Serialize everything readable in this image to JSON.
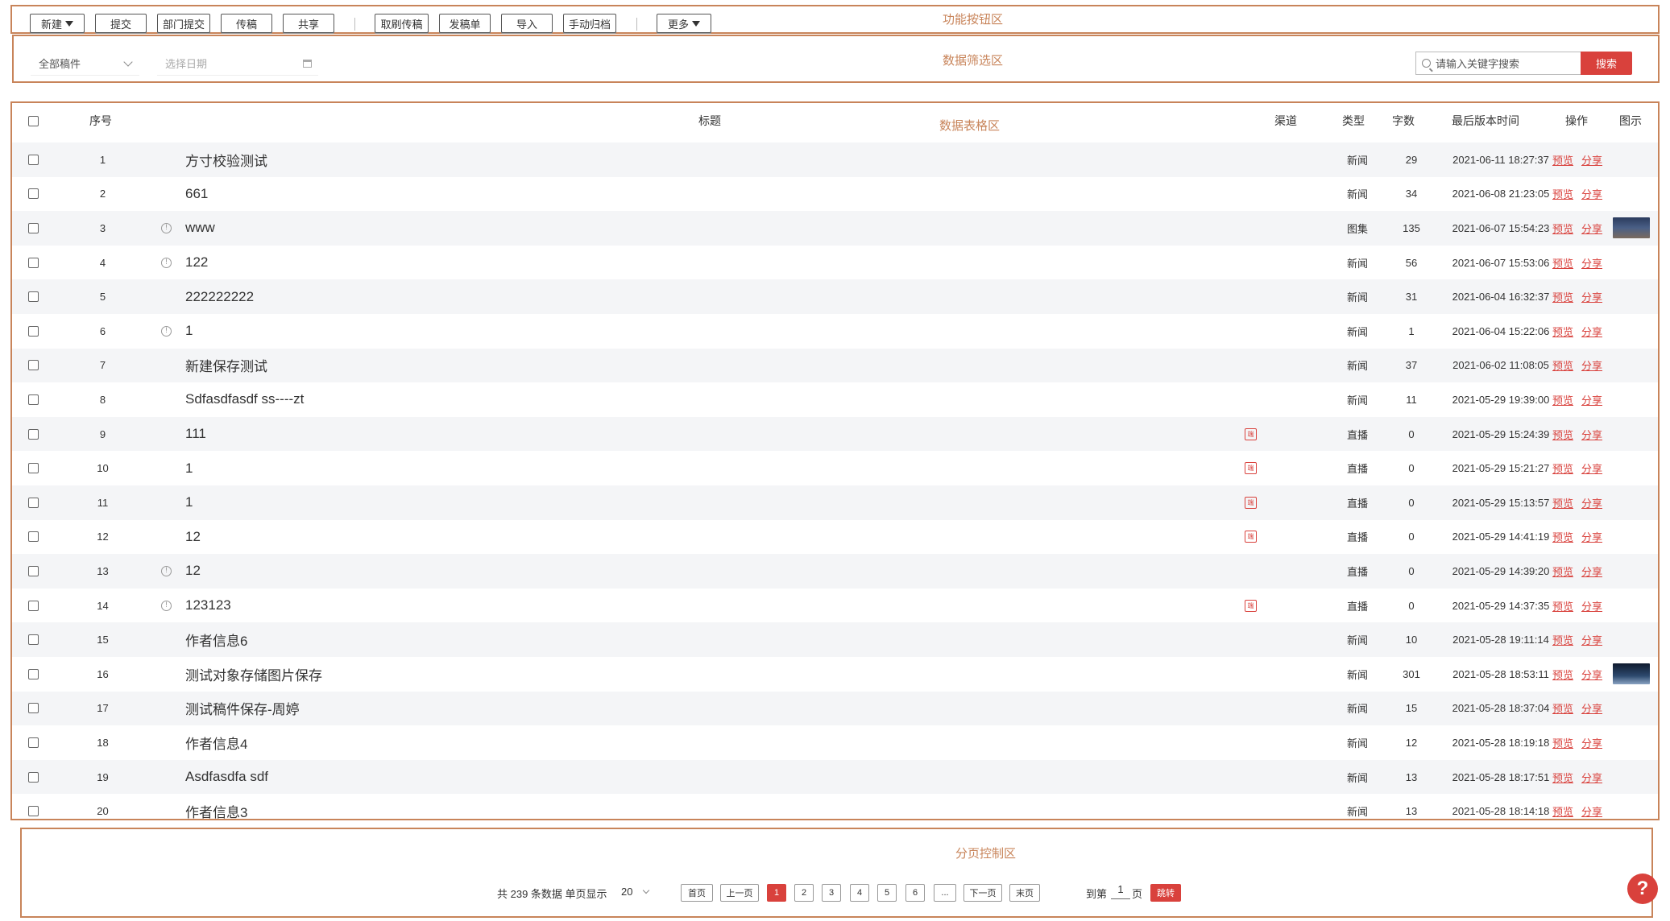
{
  "zones": {
    "toolbar_label": "功能按钮区",
    "filter_label": "数据筛选区",
    "table_label": "数据表格区",
    "pager_label": "分页控制区"
  },
  "toolbar": {
    "new": "新建",
    "submit": "提交",
    "dept_submit": "部门提交",
    "transmit": "传稿",
    "share": "共享",
    "cancel_transmit": "取刷传稿",
    "issue_list": "发稿单",
    "import": "导入",
    "manual_archive": "手动归档",
    "more": "更多"
  },
  "filter": {
    "scope": "全部稿件",
    "date_placeholder": "选择日期",
    "search_placeholder": "请输入关键字搜索",
    "search_button": "搜索"
  },
  "table": {
    "headers": {
      "index": "序号",
      "title": "标题",
      "channel": "渠道",
      "type": "类型",
      "words": "字数",
      "last_time": "最后版本时间",
      "actions": "操作",
      "image": "图示"
    },
    "preview_label": "预览",
    "share_label": "分享",
    "channel_glyph": "端",
    "info_glyph": "!",
    "rows": [
      {
        "no": "1",
        "info": false,
        "title": "方寸校验测试",
        "channel": false,
        "type": "新闻",
        "words": "29",
        "time": "2021-06-11 18:27:37",
        "thumb": ""
      },
      {
        "no": "2",
        "info": false,
        "title": "661",
        "channel": false,
        "type": "新闻",
        "words": "34",
        "time": "2021-06-08 21:23:05",
        "thumb": ""
      },
      {
        "no": "3",
        "info": true,
        "title": "www",
        "channel": false,
        "type": "图集",
        "words": "135",
        "time": "2021-06-07 15:54:23",
        "thumb": "a"
      },
      {
        "no": "4",
        "info": true,
        "title": "122",
        "channel": false,
        "type": "新闻",
        "words": "56",
        "time": "2021-06-07 15:53:06",
        "thumb": ""
      },
      {
        "no": "5",
        "info": false,
        "title": "222222222",
        "channel": false,
        "type": "新闻",
        "words": "31",
        "time": "2021-06-04 16:32:37",
        "thumb": ""
      },
      {
        "no": "6",
        "info": true,
        "title": "1",
        "channel": false,
        "type": "新闻",
        "words": "1",
        "time": "2021-06-04 15:22:06",
        "thumb": ""
      },
      {
        "no": "7",
        "info": false,
        "title": "新建保存测试",
        "channel": false,
        "type": "新闻",
        "words": "37",
        "time": "2021-06-02 11:08:05",
        "thumb": ""
      },
      {
        "no": "8",
        "info": false,
        "title": "Sdfasdfasdf ss----zt",
        "channel": false,
        "type": "新闻",
        "words": "11",
        "time": "2021-05-29 19:39:00",
        "thumb": ""
      },
      {
        "no": "9",
        "info": false,
        "title": "111",
        "channel": true,
        "type": "直播",
        "words": "0",
        "time": "2021-05-29 15:24:39",
        "thumb": ""
      },
      {
        "no": "10",
        "info": false,
        "title": "1",
        "channel": true,
        "type": "直播",
        "words": "0",
        "time": "2021-05-29 15:21:27",
        "thumb": ""
      },
      {
        "no": "11",
        "info": false,
        "title": "1",
        "channel": true,
        "type": "直播",
        "words": "0",
        "time": "2021-05-29 15:13:57",
        "thumb": ""
      },
      {
        "no": "12",
        "info": false,
        "title": "12",
        "channel": true,
        "type": "直播",
        "words": "0",
        "time": "2021-05-29 14:41:19",
        "thumb": ""
      },
      {
        "no": "13",
        "info": true,
        "title": "12",
        "channel": false,
        "type": "直播",
        "words": "0",
        "time": "2021-05-29 14:39:20",
        "thumb": ""
      },
      {
        "no": "14",
        "info": true,
        "title": "123123",
        "channel": true,
        "type": "直播",
        "words": "0",
        "time": "2021-05-29 14:37:35",
        "thumb": ""
      },
      {
        "no": "15",
        "info": false,
        "title": "作者信息6",
        "channel": false,
        "type": "新闻",
        "words": "10",
        "time": "2021-05-28 19:11:14",
        "thumb": ""
      },
      {
        "no": "16",
        "info": false,
        "title": "测试对象存储图片保存",
        "channel": false,
        "type": "新闻",
        "words": "301",
        "time": "2021-05-28 18:53:11",
        "thumb": "b"
      },
      {
        "no": "17",
        "info": false,
        "title": "测试稿件保存-周婷",
        "channel": false,
        "type": "新闻",
        "words": "15",
        "time": "2021-05-28 18:37:04",
        "thumb": ""
      },
      {
        "no": "18",
        "info": false,
        "title": "作者信息4",
        "channel": false,
        "type": "新闻",
        "words": "12",
        "time": "2021-05-28 18:19:18",
        "thumb": ""
      },
      {
        "no": "19",
        "info": false,
        "title": "Asdfasdfa sdf",
        "channel": false,
        "type": "新闻",
        "words": "13",
        "time": "2021-05-28 18:17:51",
        "thumb": ""
      },
      {
        "no": "20",
        "info": false,
        "title": "作者信息3",
        "channel": false,
        "type": "新闻",
        "words": "13",
        "time": "2021-05-28 18:14:18",
        "thumb": ""
      }
    ]
  },
  "pager": {
    "total_text": "共 239 条数据 单页显示",
    "page_size": "20",
    "first": "首页",
    "prev": "上一页",
    "pages": [
      "1",
      "2",
      "3",
      "4",
      "5",
      "6"
    ],
    "ellipsis": "...",
    "next": "下一页",
    "last": "末页",
    "goto_prefix": "到第",
    "goto_value": "1",
    "goto_suffix": "页",
    "jump": "跳转"
  },
  "help_glyph": "?",
  "colors": {
    "accent": "#d9413c",
    "annotation": "#c8845a",
    "row_alt": "#f4f5f7"
  }
}
